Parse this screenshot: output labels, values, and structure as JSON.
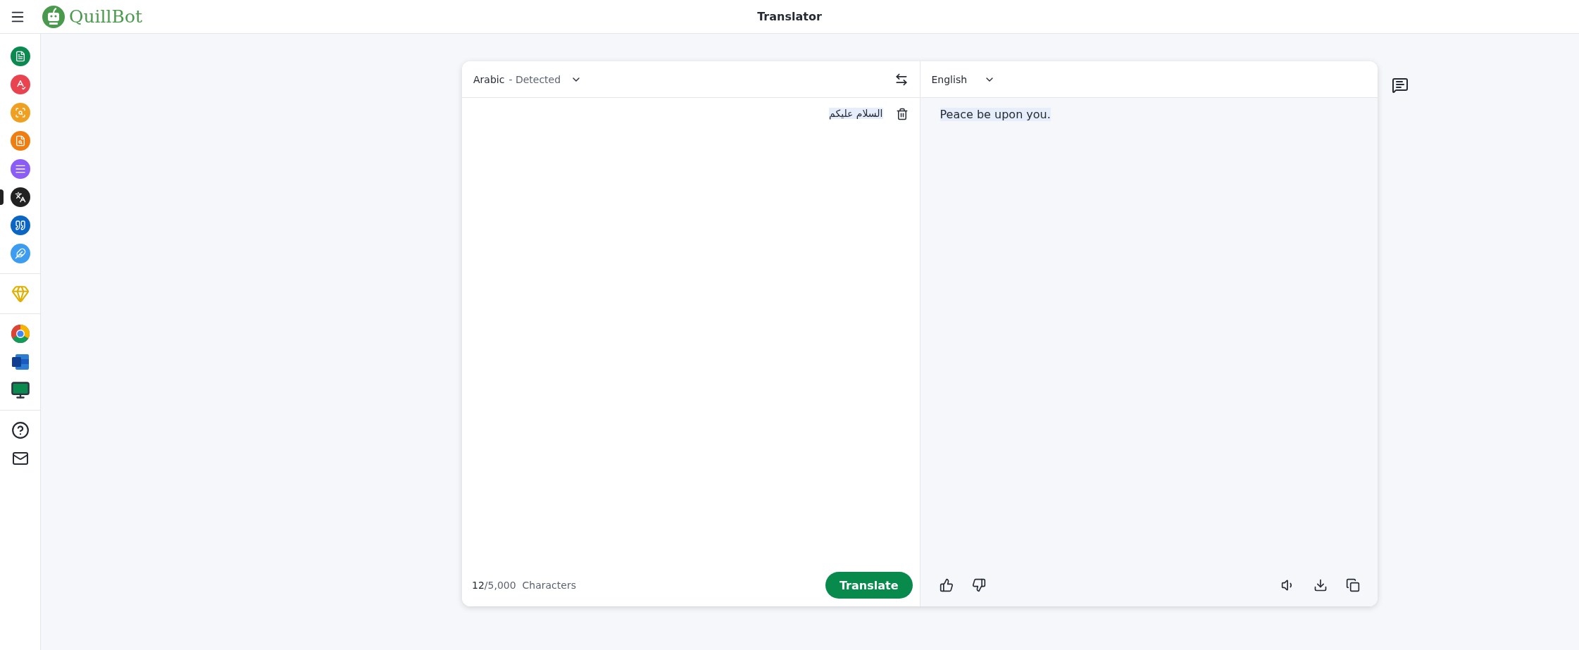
{
  "header": {
    "logo": "QuillBot",
    "title": "Translator"
  },
  "sidebar": {
    "tools": [
      {
        "color": "#0a8a4f",
        "selected": false
      },
      {
        "color": "#e8434f",
        "selected": false
      },
      {
        "color": "#f0a020",
        "selected": false
      },
      {
        "color": "#f07d10",
        "selected": false
      },
      {
        "color": "#8b5cf6",
        "selected": false
      },
      {
        "color": "#222222",
        "selected": true
      },
      {
        "color": "#0b66c3",
        "selected": false
      },
      {
        "color": "#3b9cf0",
        "selected": false
      }
    ]
  },
  "translator": {
    "source": {
      "language": "Arabic",
      "detected": "- Detected",
      "text": "السلام عليكم",
      "count": "12",
      "limit": "/5,000",
      "unit": "Characters",
      "button": "Translate"
    },
    "target": {
      "language": "English",
      "text": "Peace be upon you."
    }
  }
}
